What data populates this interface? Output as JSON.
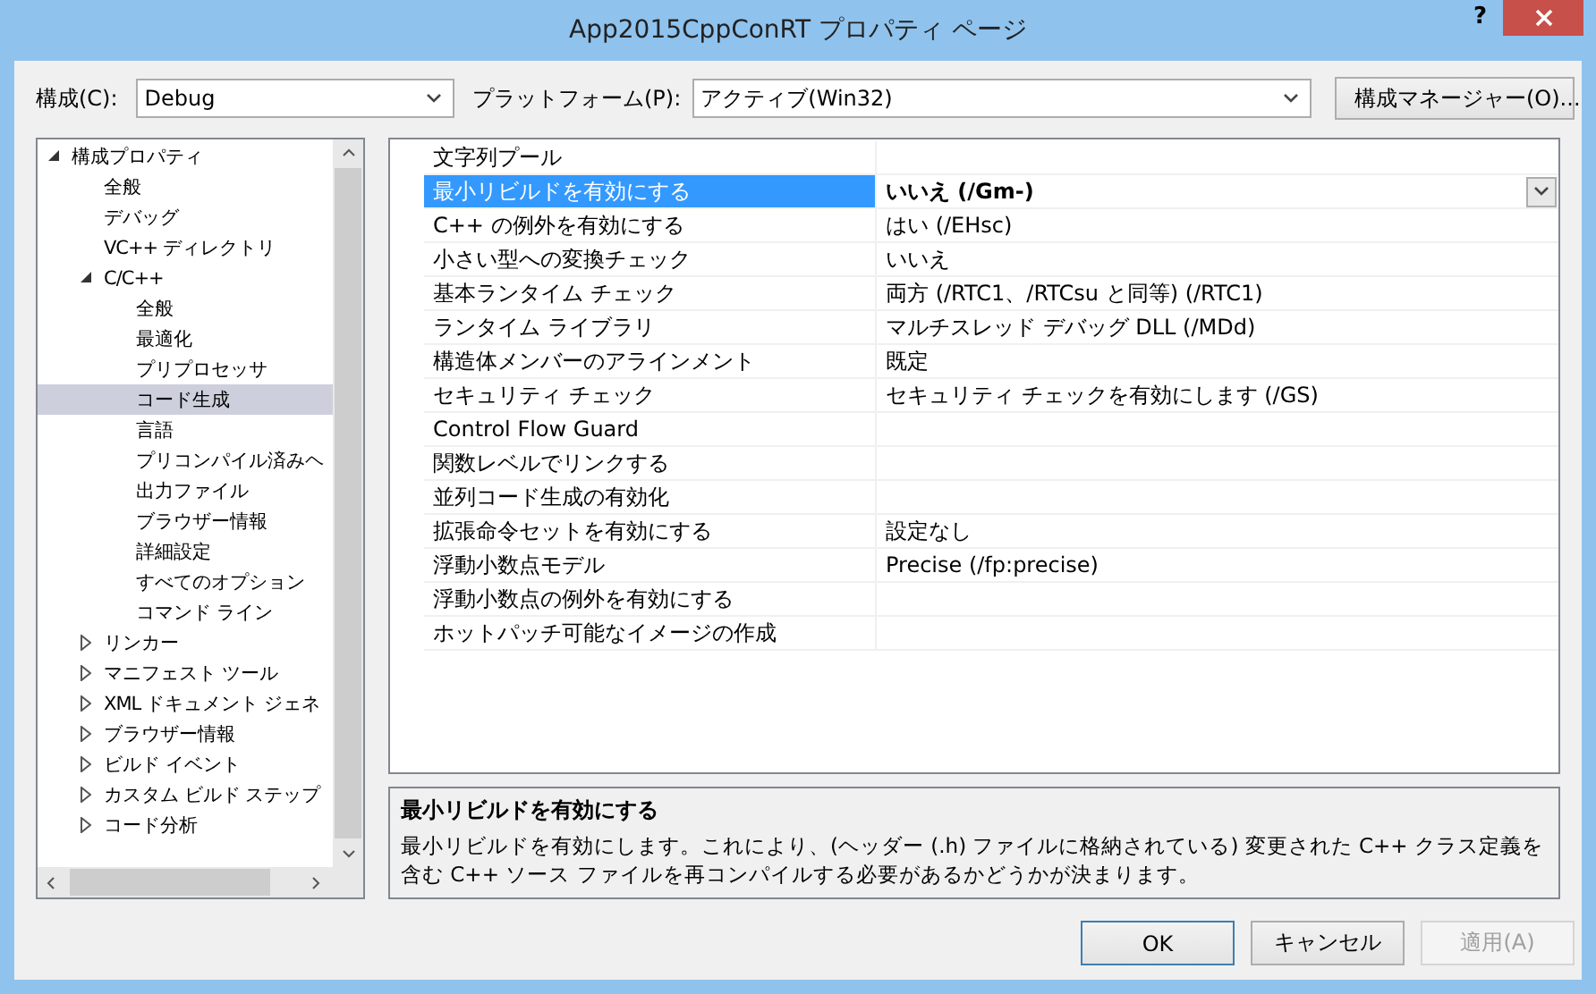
{
  "window": {
    "title": "App2015CppConRT プロパティ ページ",
    "help": "?"
  },
  "toolbar": {
    "configuration": {
      "label": "構成(C):",
      "value": "Debug"
    },
    "platform": {
      "label": "プラットフォーム(P):",
      "value": "アクティブ(Win32)"
    },
    "manager_button": "構成マネージャー(O)..."
  },
  "tree": {
    "items": [
      {
        "label": "構成プロパティ",
        "expanded": true,
        "selected": false,
        "children": [
          {
            "label": "全般",
            "selected": false
          },
          {
            "label": "デバッグ",
            "selected": false
          },
          {
            "label": "VC++ ディレクトリ",
            "selected": false
          },
          {
            "label": "C/C++",
            "expanded": true,
            "selected": false,
            "children": [
              {
                "label": "全般",
                "selected": false
              },
              {
                "label": "最適化",
                "selected": false
              },
              {
                "label": "プリプロセッサ",
                "selected": false
              },
              {
                "label": "コード生成",
                "selected": true
              },
              {
                "label": "言語",
                "selected": false
              },
              {
                "label": "プリコンパイル済みヘ",
                "selected": false
              },
              {
                "label": "出力ファイル",
                "selected": false
              },
              {
                "label": "ブラウザー情報",
                "selected": false
              },
              {
                "label": "詳細設定",
                "selected": false
              },
              {
                "label": "すべてのオプション",
                "selected": false
              },
              {
                "label": "コマンド ライン",
                "selected": false
              }
            ]
          },
          {
            "label": "リンカー",
            "expanded": false,
            "selected": false
          },
          {
            "label": "マニフェスト ツール",
            "expanded": false,
            "selected": false
          },
          {
            "label": "XML ドキュメント ジェネ",
            "expanded": false,
            "selected": false
          },
          {
            "label": "ブラウザー情報",
            "expanded": false,
            "selected": false
          },
          {
            "label": "ビルド イベント",
            "expanded": false,
            "selected": false
          },
          {
            "label": "カスタム ビルド ステップ",
            "expanded": false,
            "selected": false
          },
          {
            "label": "コード分析",
            "expanded": false,
            "selected": false
          }
        ]
      }
    ]
  },
  "grid": {
    "rows": [
      {
        "name": "文字列プール",
        "selected": false
      },
      {
        "name": "最小リビルドを有効にする",
        "value": "いいえ (/Gm-)",
        "selected": true
      },
      {
        "name": "C++ の例外を有効にする",
        "value": "はい (/EHsc)",
        "selected": false
      },
      {
        "name": "小さい型への変換チェック",
        "value": "いいえ",
        "selected": false
      },
      {
        "name": "基本ランタイム チェック",
        "value": "両方 (/RTC1、/RTCsu と同等) (/RTC1)",
        "selected": false
      },
      {
        "name": "ランタイム ライブラリ",
        "value": "マルチスレッド デバッグ DLL (/MDd)",
        "selected": false
      },
      {
        "name": "構造体メンバーのアラインメント",
        "value": "既定",
        "selected": false
      },
      {
        "name": "セキュリティ チェック",
        "value": "セキュリティ チェックを有効にします (/GS)",
        "selected": false
      },
      {
        "name": "Control Flow Guard",
        "selected": false
      },
      {
        "name": "関数レベルでリンクする",
        "selected": false
      },
      {
        "name": "並列コード生成の有効化",
        "selected": false
      },
      {
        "name": "拡張命令セットを有効にする",
        "value": "設定なし",
        "selected": false
      },
      {
        "name": "浮動小数点モデル",
        "value": "Precise (/fp:precise)",
        "selected": false
      },
      {
        "name": "浮動小数点の例外を有効にする",
        "selected": false
      },
      {
        "name": "ホットパッチ可能なイメージの作成",
        "selected": false
      }
    ]
  },
  "description": {
    "title": "最小リビルドを有効にする",
    "text": "最小リビルドを有効にします。これにより、(ヘッダー (.h) ファイルに格納されている) 変更された C++ クラス定義を含む  C++ ソース ファイルを再コンパイルする必要があるかどうかが決まります。"
  },
  "buttons": [
    {
      "label": "OK",
      "default": true,
      "disabled": false
    },
    {
      "label": "キャンセル",
      "default": false,
      "disabled": false
    },
    {
      "label": "適用(A)",
      "default": false,
      "disabled": true
    }
  ]
}
